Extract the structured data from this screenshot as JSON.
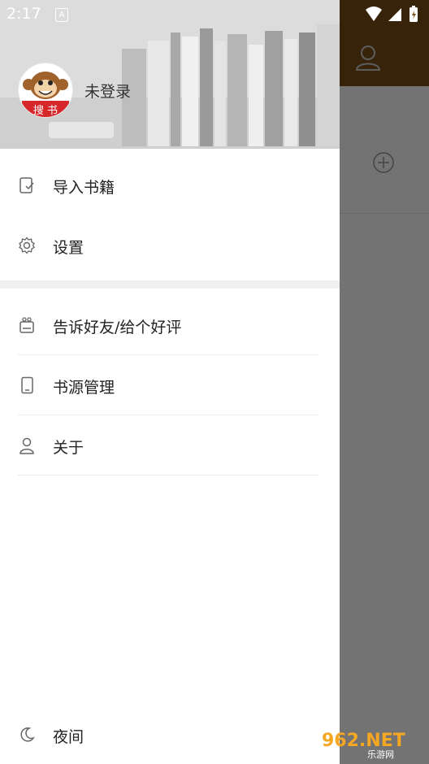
{
  "status_bar": {
    "time": "2:17",
    "notification_icon": "A"
  },
  "drawer": {
    "user": {
      "name": "未登录",
      "avatar_text": "搜 书"
    },
    "menu_section_1": [
      {
        "label": "导入书籍",
        "icon": "import-book-icon"
      },
      {
        "label": "设置",
        "icon": "gear-icon"
      }
    ],
    "menu_section_2": [
      {
        "label": "告诉好友/给个好评",
        "icon": "gift-icon"
      },
      {
        "label": "书源管理",
        "icon": "phone-icon"
      },
      {
        "label": "关于",
        "icon": "person-icon"
      }
    ],
    "night_mode": {
      "label": "夜间",
      "icon": "moon-icon"
    }
  },
  "watermark": {
    "text": "962.NET",
    "subtext": "乐游网"
  },
  "colors": {
    "header_brown": "#7a4f17",
    "scrim": "rgba(0,0,0,0.55)"
  }
}
